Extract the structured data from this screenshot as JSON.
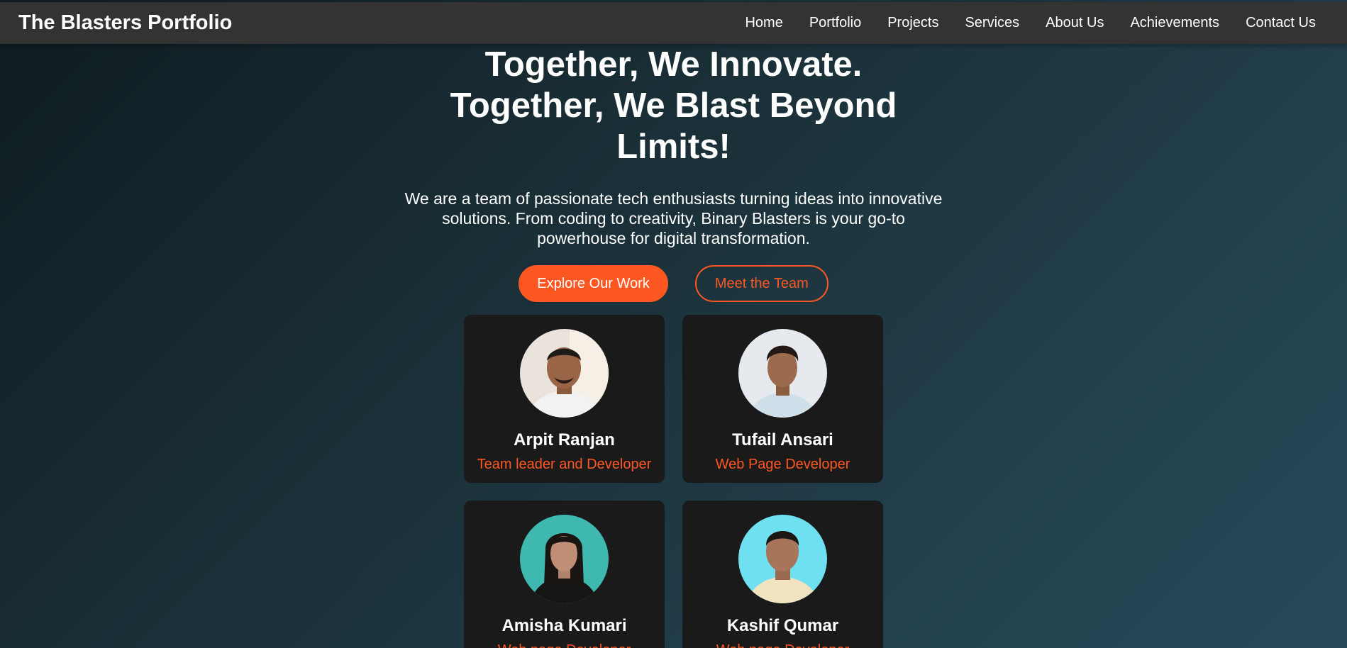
{
  "navbar": {
    "brand": "The Blasters Portfolio",
    "links": [
      "Home",
      "Portfolio",
      "Projects",
      "Services",
      "About Us",
      "Achievements",
      "Contact Us"
    ]
  },
  "hero": {
    "title_lines": [
      "Together, We Innovate.",
      "Together, We Blast Beyond",
      "Limits!"
    ],
    "description": "We are a team of passionate tech enthusiasts turning ideas into innovative solutions. From coding to creativity, Binary Blasters is your go-to powerhouse for digital transformation.",
    "primary_cta": "Explore Our Work",
    "secondary_cta": "Meet the Team"
  },
  "team": [
    {
      "name": "Arpit Ranjan",
      "role": "Team leader and Developer",
      "avatar_icon": "person-photo-icon"
    },
    {
      "name": "Tufail Ansari",
      "role": "Web Page Developer",
      "avatar_icon": "person-photo-icon"
    },
    {
      "name": "Amisha Kumari",
      "role": "Web page Developer",
      "avatar_icon": "person-photo-icon"
    },
    {
      "name": "Kashif Qumar",
      "role": "Web page Developer",
      "avatar_icon": "person-photo-icon"
    }
  ],
  "colors": {
    "accent": "#ff5722",
    "navbar_bg": "#333333",
    "card_bg": "#1a1a1a",
    "text": "#ffffff"
  }
}
